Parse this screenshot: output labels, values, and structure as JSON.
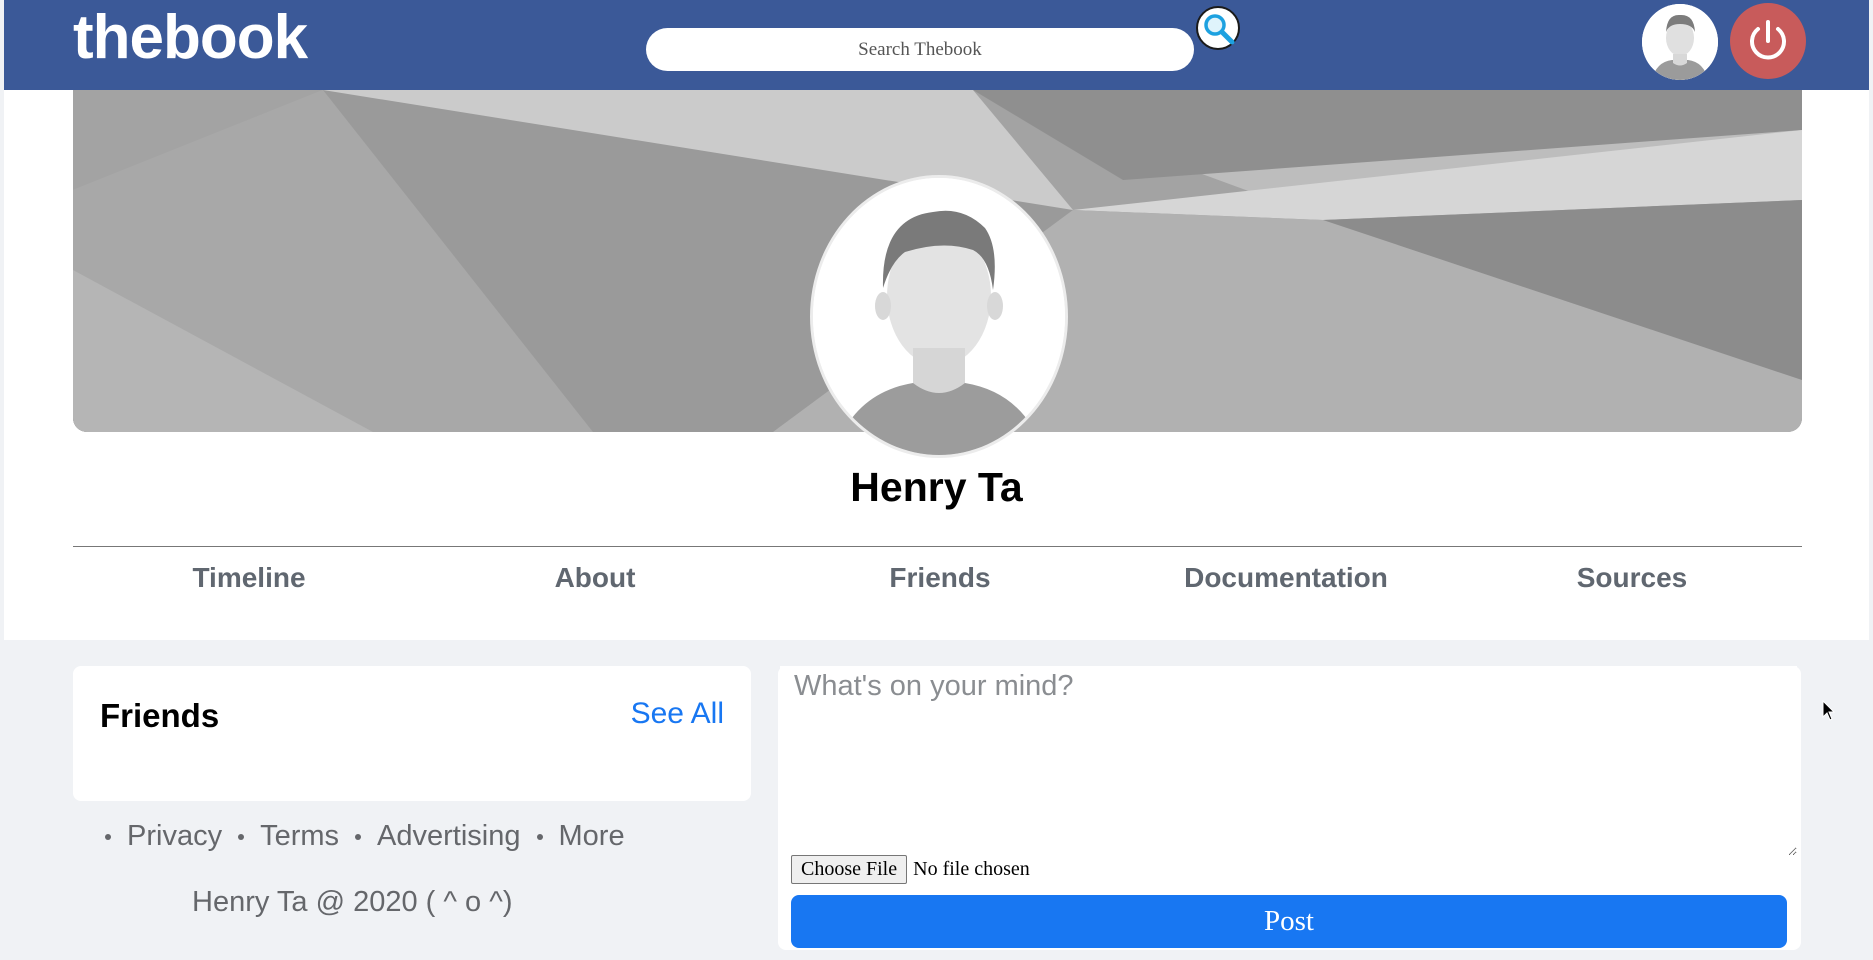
{
  "header": {
    "logo": "thebook",
    "search_placeholder": "Search Thebook",
    "brand_color": "#3b5998",
    "search_icon": "magnifier-icon",
    "user_avatar_icon": "default-avatar-icon",
    "logout_icon": "power-icon",
    "logout_color": "#c85b5b"
  },
  "profile": {
    "name": "Henry Ta",
    "tabs": [
      {
        "label": "Timeline"
      },
      {
        "label": "About"
      },
      {
        "label": "Friends"
      },
      {
        "label": "Documentation"
      },
      {
        "label": "Sources"
      }
    ]
  },
  "friends_card": {
    "title": "Friends",
    "see_all": "See All"
  },
  "footer": {
    "links": [
      "Privacy",
      "Terms",
      "Advertising",
      "More"
    ],
    "copyright": "Henry Ta @ 2020 ( ^ o ^)"
  },
  "composer": {
    "placeholder": "What's on your mind?",
    "choose_file_label": "Choose File",
    "file_status": "No file chosen",
    "post_label": "Post",
    "accent_color": "#1877f2"
  }
}
